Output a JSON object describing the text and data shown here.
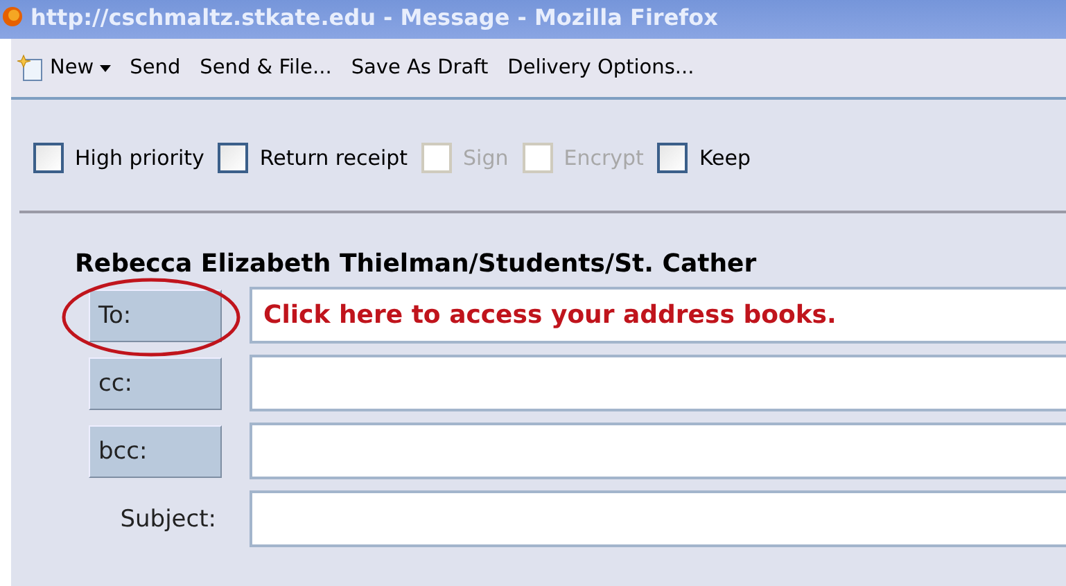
{
  "window": {
    "title": "http://cschmaltz.stkate.edu - Message - Mozilla Firefox"
  },
  "toolbar": [
    {
      "label": "New",
      "kind": "dropdown"
    },
    {
      "label": "Send",
      "kind": "plain"
    },
    {
      "label": "Send & File...",
      "kind": "plain"
    },
    {
      "label": "Save As Draft",
      "kind": "plain"
    },
    {
      "label": "Delivery Options...",
      "kind": "plain"
    }
  ],
  "options": [
    {
      "label": "High priority",
      "checked": false,
      "disabled": false
    },
    {
      "label": "Return receipt",
      "checked": false,
      "disabled": false
    },
    {
      "label": "Sign",
      "checked": false,
      "disabled": true
    },
    {
      "label": "Encrypt",
      "checked": false,
      "disabled": true
    },
    {
      "label": "Keep",
      "checked": false,
      "disabled": false
    }
  ],
  "sender": "Rebecca Elizabeth Thielman/Students/St. Cather",
  "fields": [
    {
      "label": "To:",
      "kind": "button"
    },
    {
      "label": "cc:",
      "kind": "button"
    },
    {
      "label": "bcc:",
      "kind": "button"
    },
    {
      "label": "Subject:",
      "kind": "text"
    }
  ],
  "annotation": {
    "text": "Click here to access your address books."
  }
}
